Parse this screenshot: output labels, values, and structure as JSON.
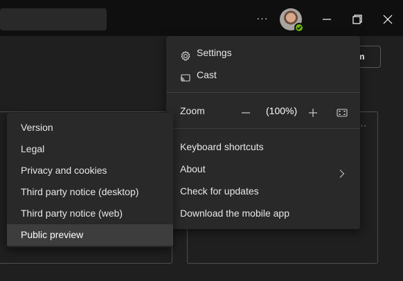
{
  "titlebar": {
    "more_label": "···",
    "icons": [
      "more-icon",
      "avatar",
      "minimize-icon",
      "maximize-icon",
      "close-icon"
    ],
    "presence_color": "#6bb700"
  },
  "background": {
    "team_button_label": "m",
    "card_more_label": "···"
  },
  "menu": {
    "settings_label": "Settings",
    "cast_label": "Cast",
    "zoom": {
      "label": "Zoom",
      "value": "(100%)"
    },
    "keyboard_shortcuts_label": "Keyboard shortcuts",
    "about_label": "About",
    "check_updates_label": "Check for updates",
    "download_mobile_label": "Download the mobile app"
  },
  "about_submenu": {
    "items": [
      {
        "label": "Version"
      },
      {
        "label": "Legal"
      },
      {
        "label": "Privacy and cookies"
      },
      {
        "label": "Third party notice (desktop)"
      },
      {
        "label": "Third party notice (web)"
      },
      {
        "label": "Public preview"
      }
    ],
    "highlighted": "Public preview"
  },
  "colors": {
    "titlebar_bg": "#0f0f0f",
    "surface_bg": "#1f1f1f",
    "menu_bg": "#292929",
    "hover_bg": "#3d3d3d"
  }
}
